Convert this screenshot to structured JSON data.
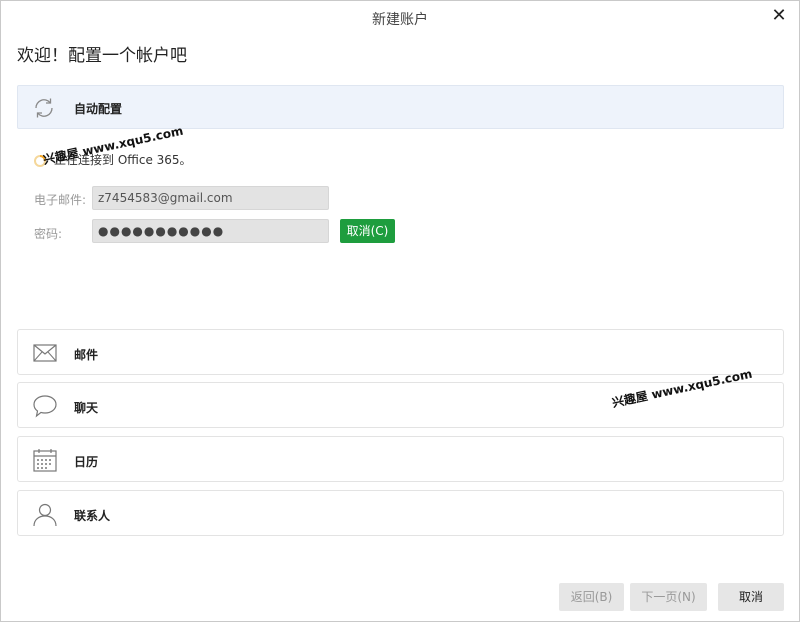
{
  "window": {
    "title": "新建账户",
    "close_symbol": "✕"
  },
  "welcome": "欢迎！配置一个帐户吧",
  "auto_config": {
    "label": "自动配置",
    "icon": "sync-icon"
  },
  "status": {
    "text": "正在连接到 Office 365。",
    "icon": "spinner-icon"
  },
  "form": {
    "email_label": "电子邮件:",
    "email_value": "z7454583@gmail.com",
    "password_label": "密码:",
    "password_value": "●●●●●●●●●●●",
    "cancel_label": "取消(C)"
  },
  "account_types": [
    {
      "label": "邮件",
      "icon": "mail-icon"
    },
    {
      "label": "聊天",
      "icon": "chat-bubble-icon"
    },
    {
      "label": "日历",
      "icon": "calendar-icon"
    },
    {
      "label": "联系人",
      "icon": "person-icon"
    }
  ],
  "footer": {
    "back_label": "返回(B)",
    "next_label": "下一页(N)",
    "cancel_label": "取消"
  },
  "watermarks": [
    "兴趣屋 www.xqu5.com",
    "兴趣屋 www.xqu5.com"
  ],
  "colors": {
    "accent_green": "#1e9d3e",
    "auto_config_bg": "#eef3fb",
    "spinner": "#f5a623"
  }
}
